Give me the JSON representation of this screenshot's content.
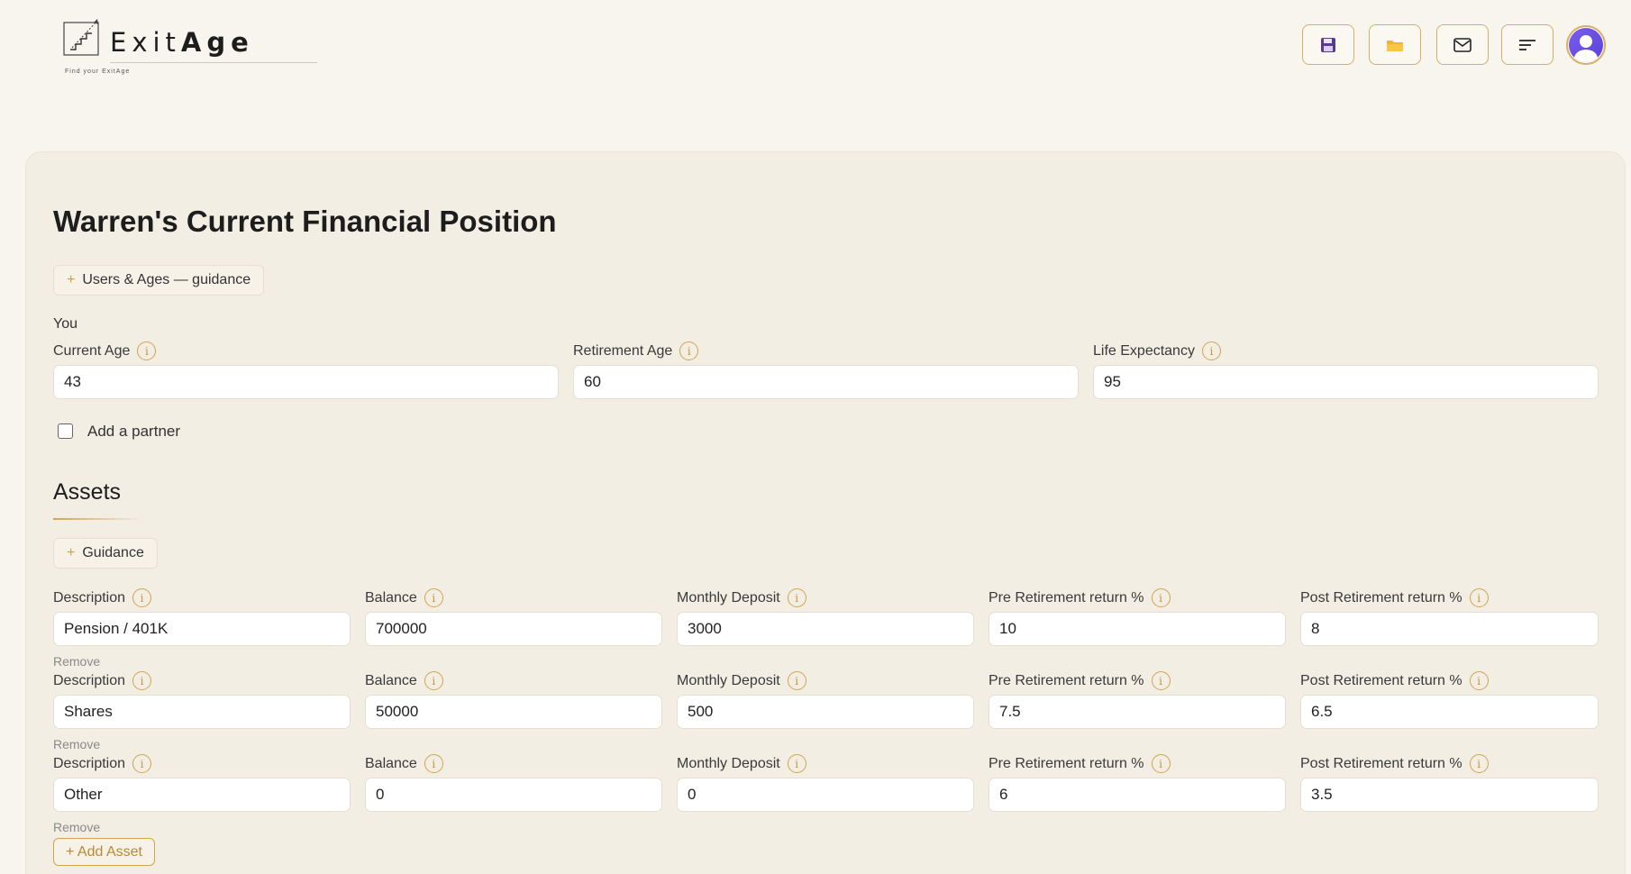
{
  "app": {
    "logo_text_a": "Exit",
    "logo_text_b": "Age",
    "tagline": "Find your ExitAge"
  },
  "header": {
    "icons": [
      "save-icon",
      "folder-icon",
      "mail-icon",
      "menu-icon",
      "user-avatar-icon"
    ],
    "accent_color": "#d7ae62"
  },
  "page": {
    "title": "Warren's Current Financial Position",
    "users_guidance_label": "Users & Ages — guidance"
  },
  "you": {
    "section_label": "You",
    "fields": [
      {
        "label": "Current Age",
        "value": "43"
      },
      {
        "label": "Retirement Age",
        "value": "60"
      },
      {
        "label": "Life Expectancy",
        "value": "95"
      }
    ],
    "partner_checkbox_label": "Add a partner",
    "partner_checked": false
  },
  "assets": {
    "title": "Assets",
    "guidance_label": "Guidance",
    "columns": [
      "Description",
      "Balance",
      "Monthly Deposit",
      "Pre Retirement return %",
      "Post Retirement return %"
    ],
    "rows": [
      {
        "description": "Pension / 401K",
        "balance": "700000",
        "monthly_deposit": "3000",
        "pre_return": "10",
        "post_return": "8"
      },
      {
        "description": "Shares",
        "balance": "50000",
        "monthly_deposit": "500",
        "pre_return": "7.5",
        "post_return": "6.5"
      },
      {
        "description": "Other",
        "balance": "0",
        "monthly_deposit": "0",
        "pre_return": "6",
        "post_return": "3.5"
      }
    ],
    "remove_label": "Remove",
    "add_label": "+ Add Asset",
    "info_glyph": "i",
    "plus_glyph": "+"
  }
}
